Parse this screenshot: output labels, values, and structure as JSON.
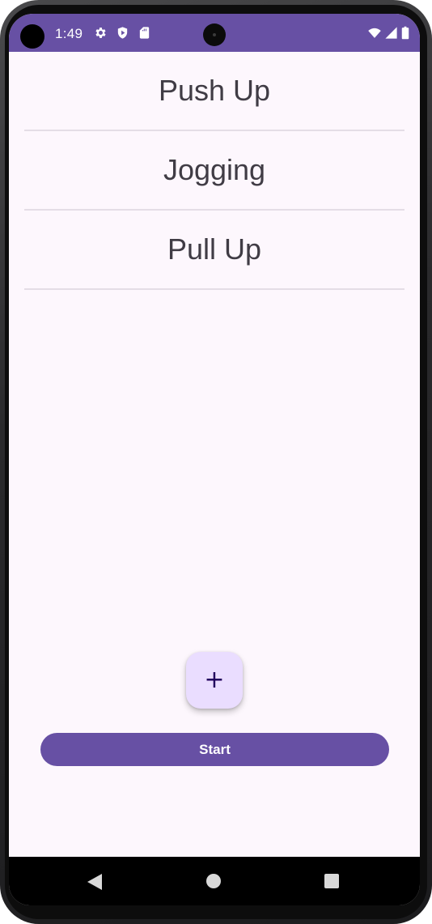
{
  "status_bar": {
    "time": "1:49",
    "left_icons": [
      "gear-icon",
      "shield-play-icon",
      "sd-card-icon"
    ],
    "right_icons": [
      "wifi-icon",
      "signal-icon",
      "battery-icon"
    ],
    "color": "#6750a4"
  },
  "exercises": {
    "items": [
      {
        "label": "Push Up"
      },
      {
        "label": "Jogging"
      },
      {
        "label": "Pull Up"
      }
    ]
  },
  "fab": {
    "label": "+",
    "icon": "plus-icon",
    "color": "#eaddff"
  },
  "start_button": {
    "label": "Start",
    "color": "#6750a4"
  },
  "nav_bar": {
    "icons": [
      "back-icon",
      "home-icon",
      "recents-icon"
    ]
  }
}
